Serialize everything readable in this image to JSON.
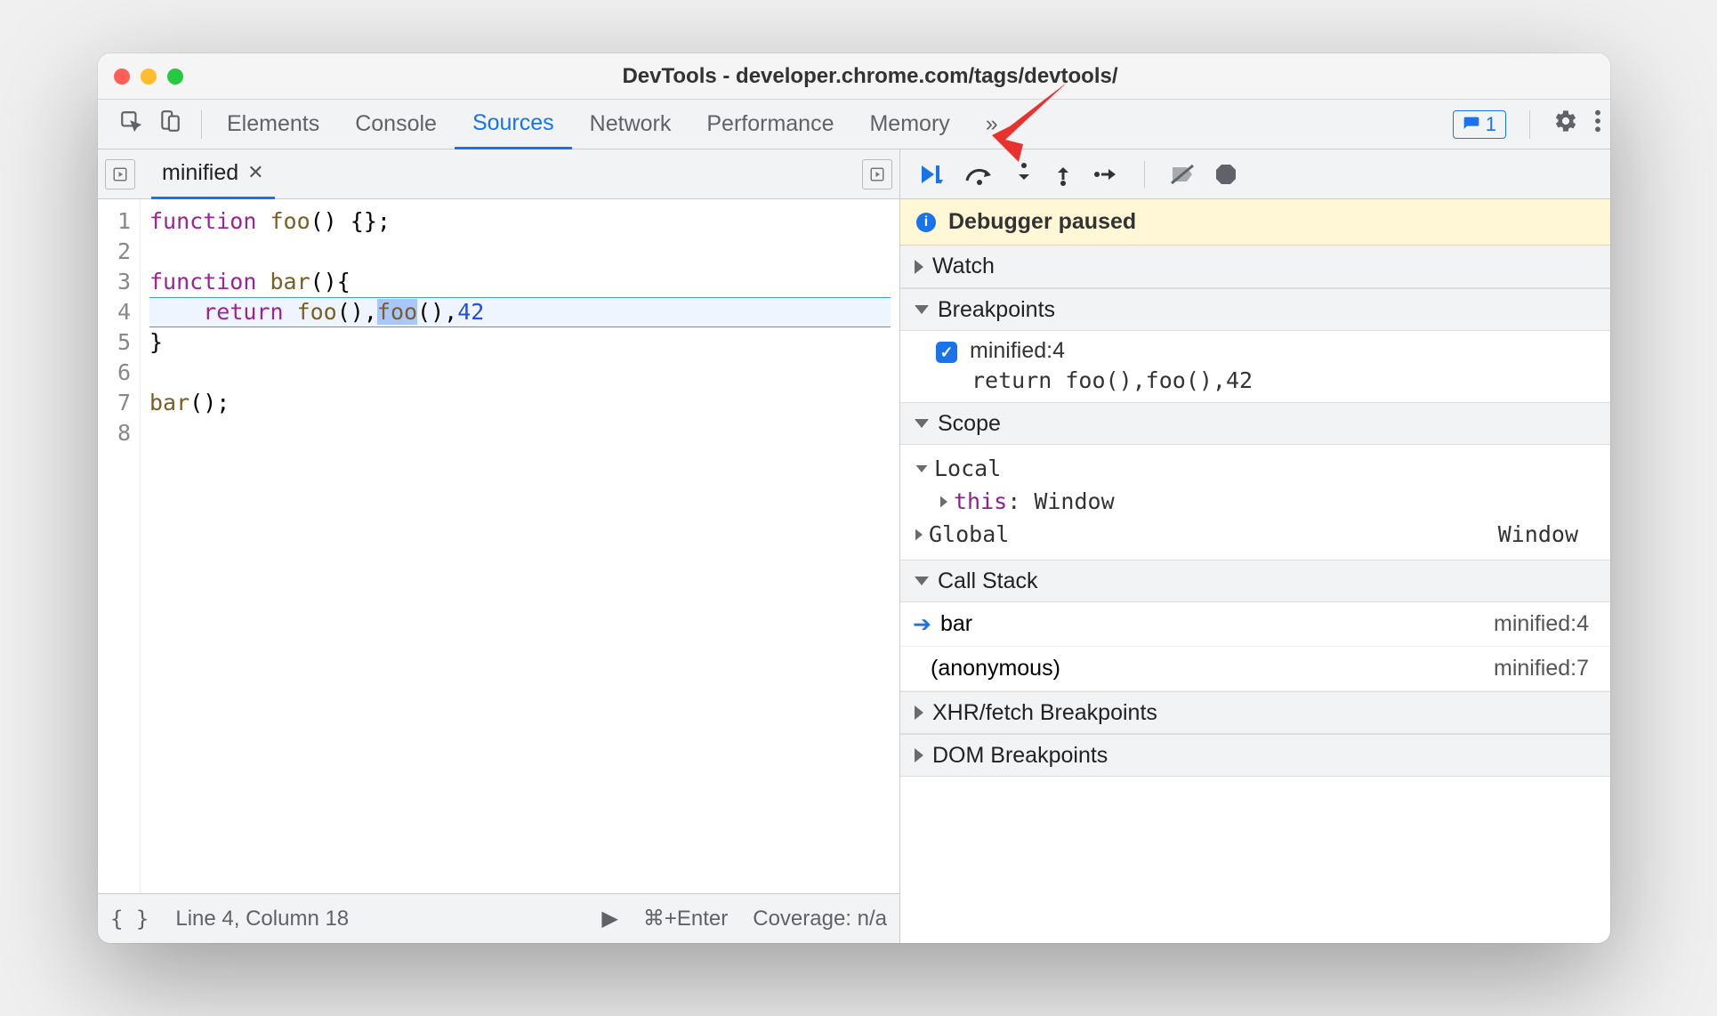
{
  "window": {
    "title": "DevTools - developer.chrome.com/tags/devtools/"
  },
  "toolbar": {
    "tabs": [
      "Elements",
      "Console",
      "Sources",
      "Network",
      "Performance",
      "Memory"
    ],
    "active": "Sources",
    "more": "»",
    "issue_count": "1"
  },
  "file": {
    "name": "minified"
  },
  "code": {
    "lines": [
      {
        "n": "1",
        "tokens": [
          {
            "t": "function ",
            "c": "kw"
          },
          {
            "t": "foo",
            "c": "fn"
          },
          {
            "t": "() {};",
            "c": ""
          }
        ]
      },
      {
        "n": "2",
        "tokens": []
      },
      {
        "n": "3",
        "tokens": [
          {
            "t": "function ",
            "c": "kw"
          },
          {
            "t": "bar",
            "c": "fn"
          },
          {
            "t": "(){",
            "c": ""
          }
        ]
      },
      {
        "n": "4",
        "tokens": [
          {
            "t": "    ",
            "c": ""
          },
          {
            "t": "return ",
            "c": "kw"
          },
          {
            "t": "foo",
            "c": "fn"
          },
          {
            "t": "(),",
            "c": ""
          },
          {
            "t": "foo",
            "c": "fn hilite"
          },
          {
            "t": "(),",
            "c": ""
          },
          {
            "t": "42",
            "c": "num"
          }
        ],
        "current": true
      },
      {
        "n": "5",
        "tokens": [
          {
            "t": "}",
            "c": ""
          }
        ]
      },
      {
        "n": "6",
        "tokens": []
      },
      {
        "n": "7",
        "tokens": [
          {
            "t": "bar",
            "c": "fn"
          },
          {
            "t": "();",
            "c": ""
          }
        ]
      },
      {
        "n": "8",
        "tokens": []
      }
    ]
  },
  "footer": {
    "pos": "Line 4, Column 18",
    "shortcut": "⌘+Enter",
    "coverage": "Coverage: n/a"
  },
  "debugger": {
    "paused": "Debugger paused",
    "sections": {
      "watch": "Watch",
      "breakpoints": "Breakpoints",
      "scope": "Scope",
      "callstack": "Call Stack",
      "xhr": "XHR/fetch Breakpoints",
      "dom": "DOM Breakpoints"
    },
    "breakpoints": [
      {
        "checked": true,
        "label": "minified:4",
        "snippet": "return foo(),foo(),42"
      }
    ],
    "scope": {
      "local": {
        "label": "Local",
        "children": [
          {
            "key": "this",
            "val": "Window"
          }
        ]
      },
      "global": {
        "label": "Global",
        "val": "Window"
      }
    },
    "callstack": [
      {
        "current": true,
        "name": "bar",
        "loc": "minified:4"
      },
      {
        "current": false,
        "name": "(anonymous)",
        "loc": "minified:7"
      }
    ]
  }
}
